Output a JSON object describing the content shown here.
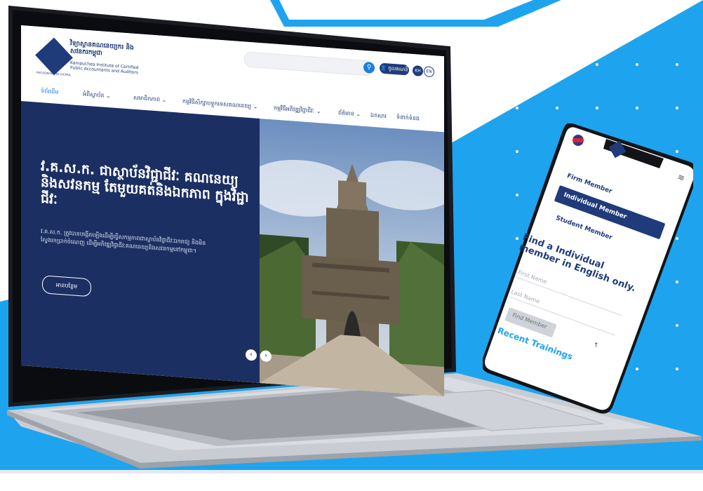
{
  "colors": {
    "accent_blue": "#1ea4ee",
    "navy": "#1f3b7a",
    "hero_bg": "#1b2f63"
  },
  "site": {
    "logo_km": "វិទ្យាស្ថានគណនេយ្យករ និងសវនករកម្ពុជា",
    "logo_en": "Kampuchea Institute of Certified Public Accountants and Auditors",
    "logo_motto": "RECOGNISED BY KICPAA",
    "login_label": "ចូលគណនី",
    "lang_kh": "KH",
    "lang_en": "EN"
  },
  "nav": {
    "items": [
      {
        "label": "ទំព័រដើម"
      },
      {
        "label": "អំពីស្ថាប័ន ⌄"
      },
      {
        "label": "សមាជិកភាព ⌄"
      },
      {
        "label": "កម្មវិធីសិក្សាបទ្ទុកទេសគណនេយ្យ ⌄"
      },
      {
        "label": "កម្មវិធីអភិវឌ្ឍវិជ្ជាជីវៈ ⌄"
      },
      {
        "label": "ព័ត៌មាន ⌄"
      },
      {
        "label": "ឯកសារ"
      },
      {
        "label": "ទំនាក់ទំនង"
      }
    ]
  },
  "hero": {
    "title": "វ.គ.ស.ក. ជាស្ថាប័នវិជ្ជាជីវៈ គណនេយ្យ និងសវនកម្ម តែមួយគត់និងឯកភាព ក្នុងវិជ្ជាជីវៈ",
    "description": "វ.គ.ស.ក. ត្រូវបានបង្កើតឡើងដើម្បីធ្វើសកម្មភាពជាស្ថាប័នវិជ្ជាជីវៈឯករាជ្យ និងមិនស្វែងរកប្រាក់ចំណេញ ដើម្បីអភិវឌ្ឍវិជ្ជាជីវៈគណនេយ្យនិងសវនកម្មនៅកម្ពុជា។",
    "button_label": "អានបន្ថែម",
    "prev": "‹",
    "next": "›"
  },
  "phone": {
    "menu": [
      "Firm Member",
      "Individual Member",
      "Student Member"
    ],
    "active_index": 1,
    "heading": "Find a Individual member in English only.",
    "first_name_placeholder": "First Name",
    "last_name_placeholder": "Last Name",
    "find_button": "Find Member",
    "recent": "Recent Trainings"
  }
}
